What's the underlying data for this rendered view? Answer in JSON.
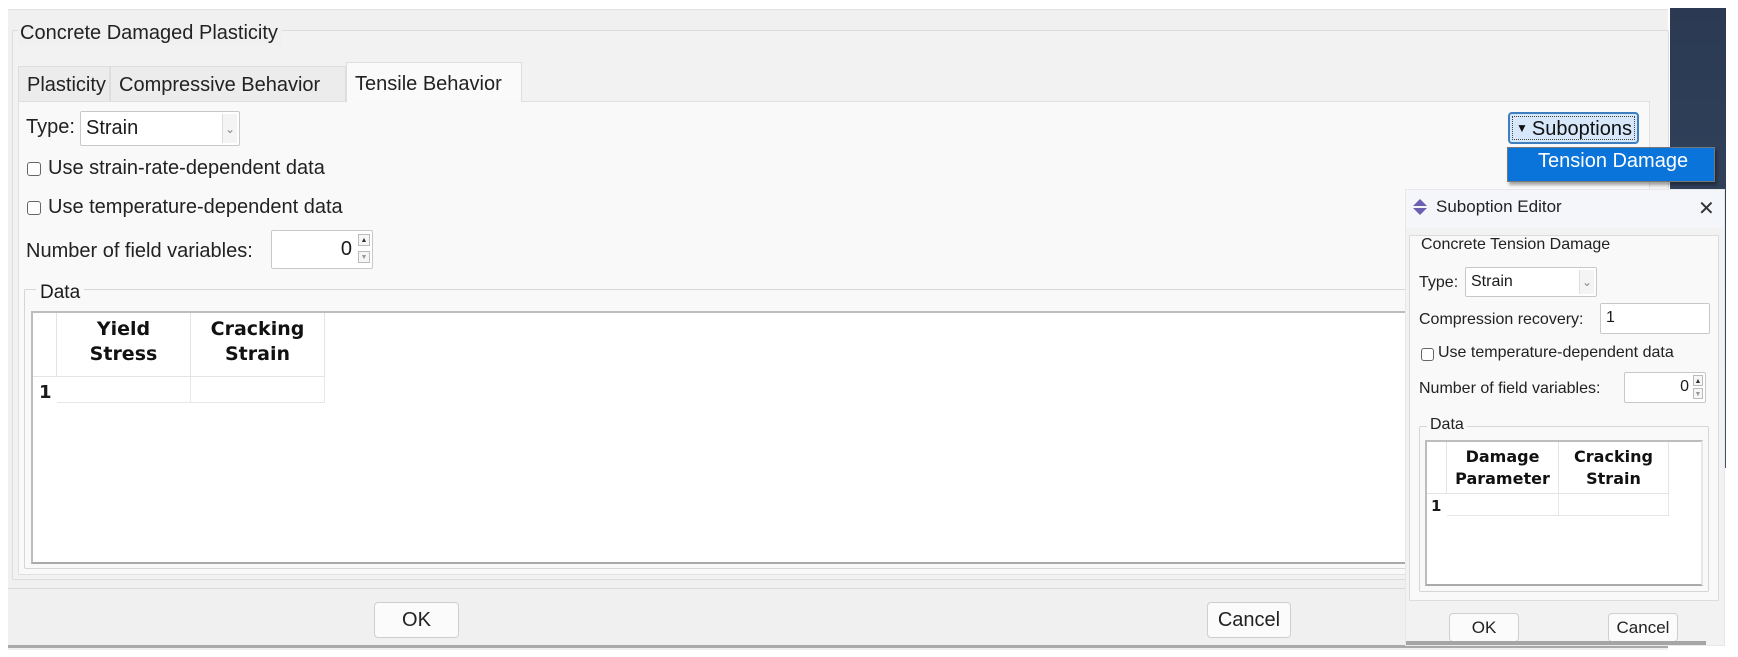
{
  "main_dialog": {
    "group_title": "Concrete Damaged Plasticity",
    "tabs": [
      {
        "label": "Plasticity",
        "active": false
      },
      {
        "label": "Compressive Behavior",
        "active": false
      },
      {
        "label": "Tensile Behavior",
        "active": true
      }
    ],
    "type_label": "Type:",
    "type_value": "Strain",
    "checkboxes": [
      {
        "label": "Use strain-rate-dependent data",
        "checked": false
      },
      {
        "label": "Use temperature-dependent data",
        "checked": false
      }
    ],
    "field_vars_label": "Number of field variables:",
    "field_vars_value": "0",
    "data_group_title": "Data",
    "table": {
      "columns": [
        [
          "Yield",
          "Stress"
        ],
        [
          "Cracking",
          "Strain"
        ]
      ],
      "rows": [
        {
          "index": "1",
          "cells": [
            "",
            ""
          ]
        }
      ]
    },
    "suboptions_label": "Suboptions",
    "suboptions_menu": [
      "Tension Damage"
    ],
    "ok_label": "OK",
    "cancel_label": "Cancel"
  },
  "suboption_editor": {
    "title": "Suboption Editor",
    "close_icon": "close-icon",
    "group_title": "Concrete Tension Damage",
    "type_label": "Type:",
    "type_value": "Strain",
    "compression_recovery_label": "Compression recovery:",
    "compression_recovery_value": "1",
    "checkbox": {
      "label": "Use temperature-dependent data",
      "checked": false
    },
    "field_vars_label": "Number of field variables:",
    "field_vars_value": "0",
    "data_group_title": "Data",
    "table": {
      "columns": [
        [
          "Damage",
          "Parameter"
        ],
        [
          "Cracking",
          "Strain"
        ]
      ],
      "rows": [
        {
          "index": "1",
          "cells": [
            "",
            ""
          ]
        }
      ]
    },
    "ok_label": "OK",
    "cancel_label": "Cancel"
  },
  "colors": {
    "menu_highlight": "#0a74da",
    "suboptions_button_bg": "#d6e8fa",
    "suboptions_button_border": "#3d7fc1"
  }
}
